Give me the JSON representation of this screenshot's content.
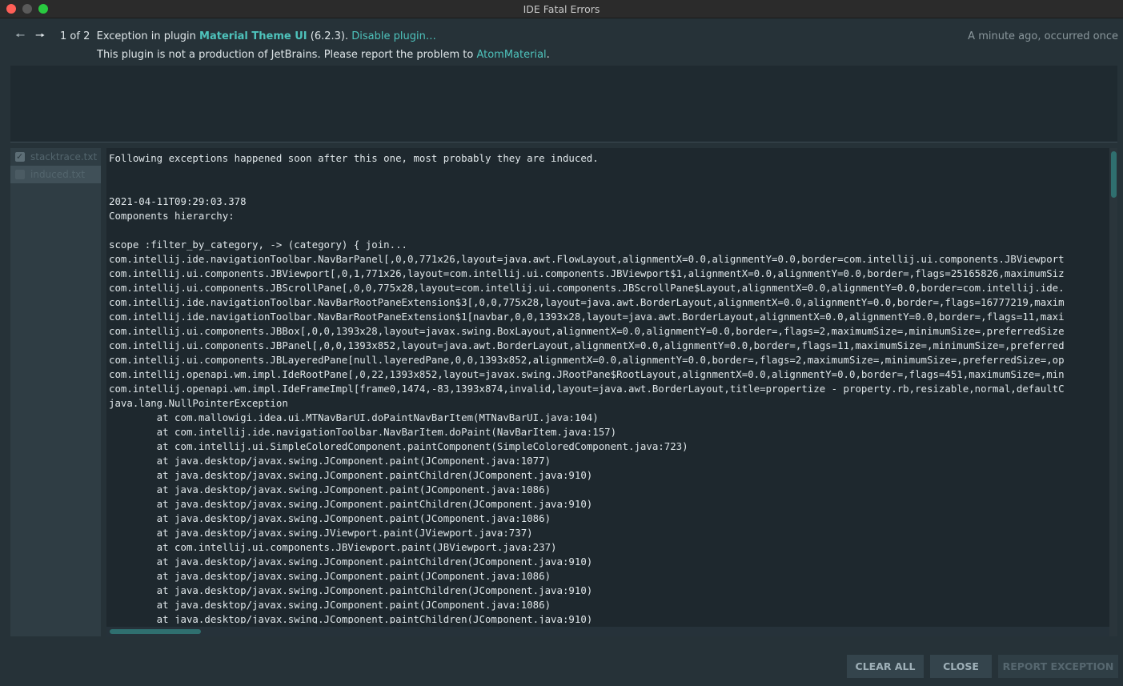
{
  "window": {
    "title": "IDE Fatal Errors"
  },
  "header": {
    "prev_icon": "arrow-left-icon",
    "next_icon": "arrow-right-icon",
    "counter": "1 of 2",
    "exception_prefix": "Exception in plugin ",
    "plugin_name": "Material Theme UI",
    "plugin_version": " (6.2.3). ",
    "disable_link": "Disable plugin…",
    "note_prefix": "This plugin is not a production of JetBrains. Please report the problem to ",
    "note_link": "AtomMaterial",
    "note_suffix": ".",
    "timestamp": "A minute ago, occurred once"
  },
  "files": [
    {
      "name": "stacktrace.txt",
      "checked": true,
      "selected": false
    },
    {
      "name": "induced.txt",
      "checked": false,
      "selected": true
    }
  ],
  "log_lines": [
    "Following exceptions happened soon after this one, most probably they are induced.",
    "",
    "",
    "2021-04-11T09:29:03.378",
    "Components hierarchy:",
    "",
    "scope :filter_by_category, -> (category) { join...",
    "com.intellij.ide.navigationToolbar.NavBarPanel[,0,0,771x26,layout=java.awt.FlowLayout,alignmentX=0.0,alignmentY=0.0,border=com.intellij.ui.components.JBViewport",
    "com.intellij.ui.components.JBViewport[,0,1,771x26,layout=com.intellij.ui.components.JBViewport$1,alignmentX=0.0,alignmentY=0.0,border=,flags=25165826,maximumSiz",
    "com.intellij.ui.components.JBScrollPane[,0,0,775x28,layout=com.intellij.ui.components.JBScrollPane$Layout,alignmentX=0.0,alignmentY=0.0,border=com.intellij.ide.",
    "com.intellij.ide.navigationToolbar.NavBarRootPaneExtension$3[,0,0,775x28,layout=java.awt.BorderLayout,alignmentX=0.0,alignmentY=0.0,border=,flags=16777219,maxim",
    "com.intellij.ide.navigationToolbar.NavBarRootPaneExtension$1[navbar,0,0,1393x28,layout=java.awt.BorderLayout,alignmentX=0.0,alignmentY=0.0,border=,flags=11,maxi",
    "com.intellij.ui.components.JBBox[,0,0,1393x28,layout=javax.swing.BoxLayout,alignmentX=0.0,alignmentY=0.0,border=,flags=2,maximumSize=,minimumSize=,preferredSize",
    "com.intellij.ui.components.JBPanel[,0,0,1393x852,layout=java.awt.BorderLayout,alignmentX=0.0,alignmentY=0.0,border=,flags=11,maximumSize=,minimumSize=,preferred",
    "com.intellij.ui.components.JBLayeredPane[null.layeredPane,0,0,1393x852,alignmentX=0.0,alignmentY=0.0,border=,flags=2,maximumSize=,minimumSize=,preferredSize=,op",
    "com.intellij.openapi.wm.impl.IdeRootPane[,0,22,1393x852,layout=javax.swing.JRootPane$RootLayout,alignmentX=0.0,alignmentY=0.0,border=,flags=451,maximumSize=,min",
    "com.intellij.openapi.wm.impl.IdeFrameImpl[frame0,1474,-83,1393x874,invalid,layout=java.awt.BorderLayout,title=propertize - property.rb,resizable,normal,defaultC",
    "java.lang.NullPointerException",
    "        at com.mallowigi.idea.ui.MTNavBarUI.doPaintNavBarItem(MTNavBarUI.java:104)",
    "        at com.intellij.ide.navigationToolbar.NavBarItem.doPaint(NavBarItem.java:157)",
    "        at com.intellij.ui.SimpleColoredComponent.paintComponent(SimpleColoredComponent.java:723)",
    "        at java.desktop/javax.swing.JComponent.paint(JComponent.java:1077)",
    "        at java.desktop/javax.swing.JComponent.paintChildren(JComponent.java:910)",
    "        at java.desktop/javax.swing.JComponent.paint(JComponent.java:1086)",
    "        at java.desktop/javax.swing.JComponent.paintChildren(JComponent.java:910)",
    "        at java.desktop/javax.swing.JComponent.paint(JComponent.java:1086)",
    "        at java.desktop/javax.swing.JViewport.paint(JViewport.java:737)",
    "        at com.intellij.ui.components.JBViewport.paint(JBViewport.java:237)",
    "        at java.desktop/javax.swing.JComponent.paintChildren(JComponent.java:910)",
    "        at java.desktop/javax.swing.JComponent.paint(JComponent.java:1086)",
    "        at java.desktop/javax.swing.JComponent.paintChildren(JComponent.java:910)",
    "        at java.desktop/javax.swing.JComponent.paint(JComponent.java:1086)",
    "        at java.desktop/javax.swing.JComponent.paintChildren(JComponent.java:910)"
  ],
  "buttons": {
    "clear_all": "CLEAR ALL",
    "close": "CLOSE",
    "report": "REPORT EXCEPTION"
  },
  "colors": {
    "background": "#263238",
    "accent": "#4ec3bc",
    "log_background": "#1e282e"
  }
}
